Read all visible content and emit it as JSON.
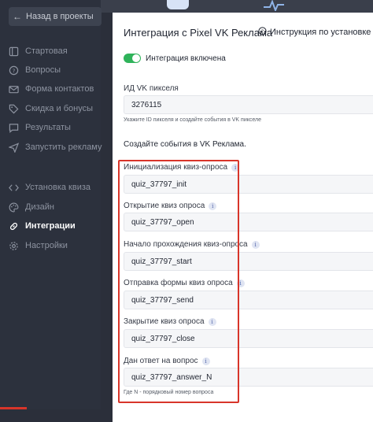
{
  "sidebar": {
    "back_label": "Назад в проекты",
    "items": [
      {
        "label": "Стартовая",
        "icon": "square-icon"
      },
      {
        "label": "Вопросы",
        "icon": "help-circle-icon"
      },
      {
        "label": "Форма контактов",
        "icon": "mail-icon"
      },
      {
        "label": "Скидка и бонусы",
        "icon": "tag-icon"
      },
      {
        "label": "Результаты",
        "icon": "chat-icon"
      },
      {
        "label": "Запустить рекламу",
        "icon": "send-icon"
      },
      {
        "label": "Установка квиза",
        "icon": "embed-icon"
      },
      {
        "label": "Дизайн",
        "icon": "palette-icon"
      },
      {
        "label": "Интеграции",
        "icon": "link-icon"
      },
      {
        "label": "Настройки",
        "icon": "gear-icon"
      }
    ],
    "active": "Интеграции"
  },
  "panel": {
    "title": "Интеграция с Pixel VK Реклама",
    "instructions_link": "Инструкция по установке",
    "toggle_label": "Интеграция включена",
    "toggle_on": true,
    "pixel_id_label": "ИД VK пикселя",
    "pixel_id_value": "3276115",
    "pixel_id_hint": "Укажите ID пикселя и создайте события в VK пикселе",
    "events_title": "Создайте события в VK Реклама.",
    "events": [
      {
        "label": "Инициализация квиз-опроса",
        "value": "quiz_37797_init"
      },
      {
        "label": "Открытие квиз опроса",
        "value": "quiz_37797_open"
      },
      {
        "label": "Начало прохождения квиз-опроса",
        "value": "quiz_37797_start"
      },
      {
        "label": "Отправка формы квиз опроса",
        "value": "quiz_37797_send"
      },
      {
        "label": "Закрытие квиз опроса",
        "value": "quiz_37797_close"
      },
      {
        "label": "Дан ответ на вопрос",
        "value": "quiz_37797_answer_N"
      }
    ],
    "answer_hint": "Где N - порядковый номер вопроса",
    "info_glyph": "i"
  },
  "colors": {
    "sidebar_bg": "#2c313d",
    "toggle_on": "#2fb35a",
    "highlight": "#d8352a"
  }
}
